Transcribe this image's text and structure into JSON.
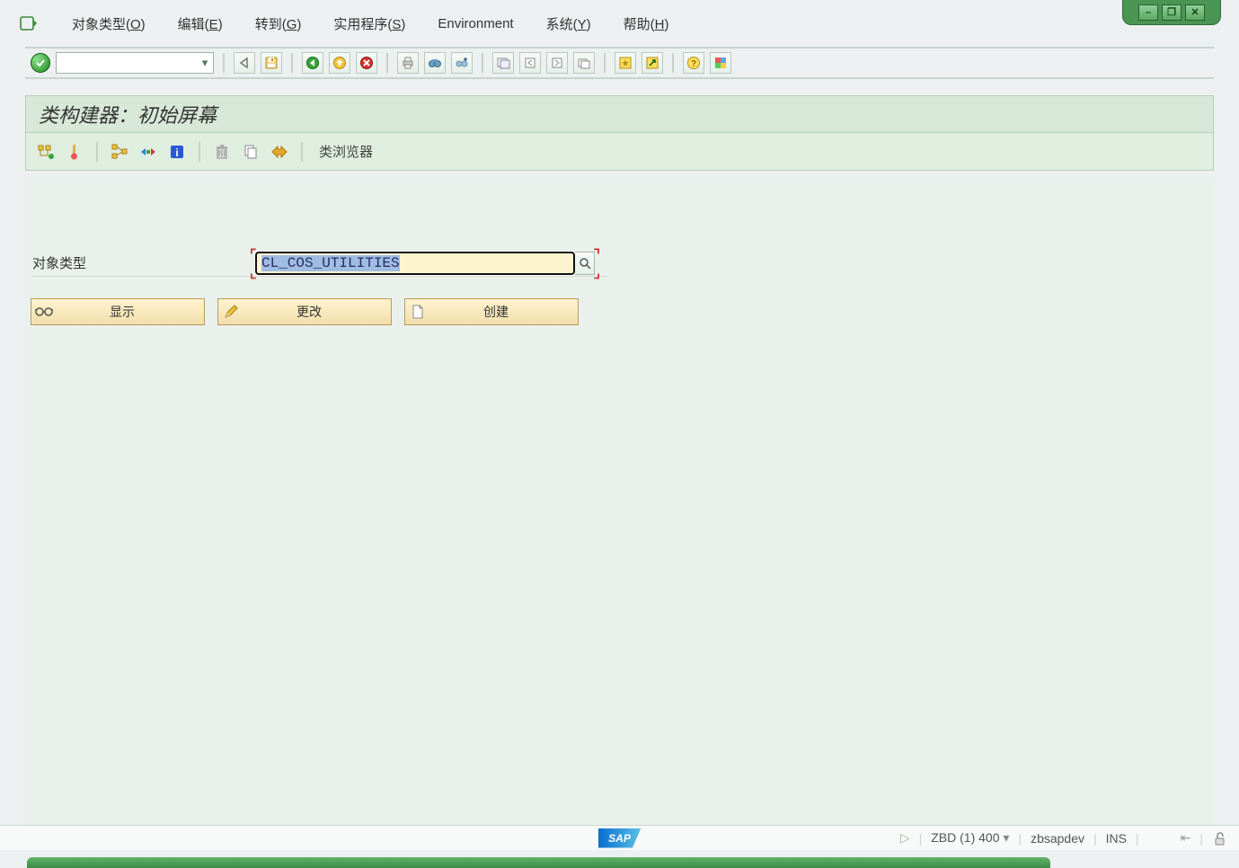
{
  "menu": {
    "items": [
      {
        "label": "对象类型(",
        "hot": "O",
        "tail": ")"
      },
      {
        "label": "编辑(",
        "hot": "E",
        "tail": ")"
      },
      {
        "label": "转到(",
        "hot": "G",
        "tail": ")"
      },
      {
        "label": "实用程序(",
        "hot": "S",
        "tail": ")"
      },
      {
        "label": "Environment",
        "hot": "",
        "tail": ""
      },
      {
        "label": "系统(",
        "hot": "Y",
        "tail": ")"
      },
      {
        "label": "帮助(",
        "hot": "H",
        "tail": ")"
      }
    ]
  },
  "app": {
    "title": "类构建器：初始屏幕",
    "toolbar_label": "类浏览器"
  },
  "form": {
    "field_label": "对象类型",
    "object_value": "CL_COS_UTILITIES"
  },
  "buttons": {
    "display": "显示",
    "change": "更改",
    "create": "创建"
  },
  "status": {
    "system": "ZBD (1) 400",
    "server": "zbsapdev",
    "mode": "INS",
    "logo": "SAP"
  },
  "icons": {
    "ok": "✓",
    "back": "◁",
    "save": "💾",
    "prev": "◀",
    "up": "⬆",
    "cancel": "✖",
    "print": "🖨",
    "find": "🔍",
    "findnext": "🔎",
    "newwin": "🗗",
    "genwin": "🗔",
    "link": "🔗",
    "short": "🧩",
    "star": "✳",
    "box": "▦",
    "help": "?",
    "palette": "🎨",
    "glasses": "👓",
    "pencil": "✎",
    "page": "📄",
    "search": "🔍",
    "tree": "🌳",
    "info": "ℹ",
    "trash": "🗑",
    "copy": "📋",
    "arrow2": "➮",
    "dd": "▾",
    "lock": "🔓",
    "tab": "⇤",
    "min": "–",
    "rest": "❐",
    "close": "✕",
    "tri": "▷"
  }
}
